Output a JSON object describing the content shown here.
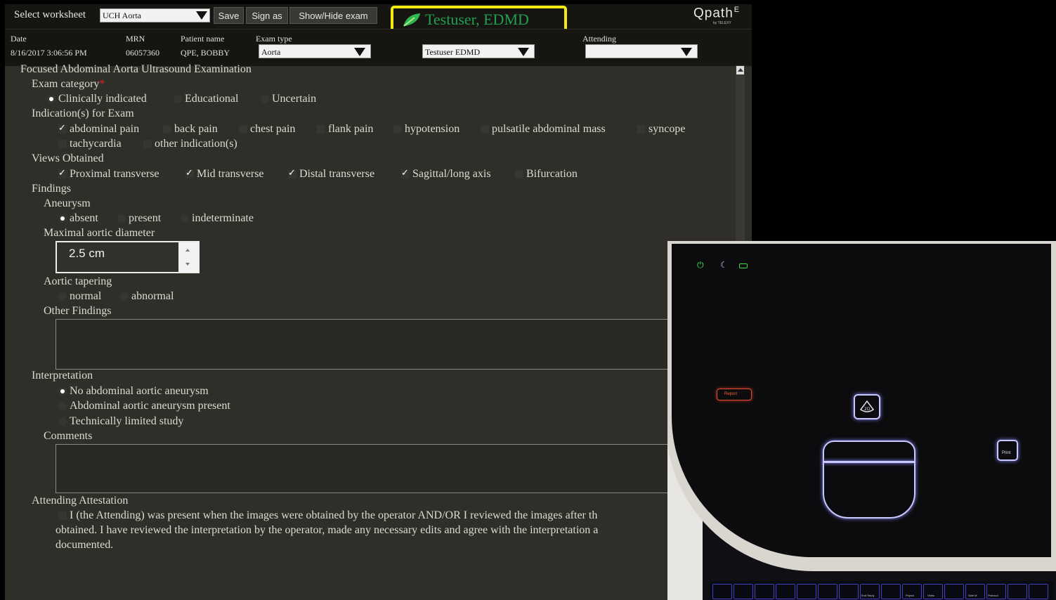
{
  "toolbar": {
    "select_worksheet_label": "Select worksheet",
    "worksheet_value": "UCH Aorta",
    "save_label": "Save",
    "sign_as_label": "Sign as",
    "show_hide_label": "Show/Hide exam",
    "user_name": "Testuser, EDMD",
    "logo": "Qpath",
    "logo_suffix": "E",
    "logo_sub": "by TELEXY"
  },
  "header": {
    "date_label": "Date",
    "date_value": "8/16/2017 3:06:56 PM",
    "mrn_label": "MRN",
    "mrn_value": "06057360",
    "patient_label": "Patient name",
    "patient_value": "QPE, BOBBY",
    "exam_type_label": "Exam type",
    "exam_type_value": "Aorta",
    "operator_value": "Testuser EDMD",
    "attending_label": "Attending",
    "attending_value": ""
  },
  "form": {
    "title": "Focused Abdominal Aorta Ultrasound Examination",
    "exam_category": {
      "label": "Exam category",
      "required_mark": "*",
      "options": [
        {
          "label": "Clinically indicated",
          "selected": true
        },
        {
          "label": "Educational",
          "selected": false
        },
        {
          "label": "Uncertain",
          "selected": false
        }
      ]
    },
    "indications": {
      "label": "Indication(s) for Exam",
      "options": [
        {
          "label": "abdominal pain",
          "checked": true
        },
        {
          "label": "back pain",
          "checked": false
        },
        {
          "label": "chest pain",
          "checked": false
        },
        {
          "label": "flank pain",
          "checked": false
        },
        {
          "label": "hypotension",
          "checked": false
        },
        {
          "label": "pulsatile abdominal mass",
          "checked": false
        },
        {
          "label": "syncope",
          "checked": false
        },
        {
          "label": "tachycardia",
          "checked": false
        },
        {
          "label": "other indication(s)",
          "checked": false
        }
      ]
    },
    "views": {
      "label": "Views Obtained",
      "options": [
        {
          "label": "Proximal transverse",
          "checked": true
        },
        {
          "label": "Mid transverse",
          "checked": true
        },
        {
          "label": "Distal transverse",
          "checked": true
        },
        {
          "label": "Sagittal/long axis",
          "checked": true
        },
        {
          "label": "Bifurcation",
          "checked": false
        }
      ]
    },
    "findings_label": "Findings",
    "aneurysm": {
      "label": "Aneurysm",
      "options": [
        {
          "label": "absent",
          "selected": true
        },
        {
          "label": "present",
          "selected": false
        },
        {
          "label": "indeterminate",
          "selected": false
        }
      ]
    },
    "diameter": {
      "label": "Maximal aortic diameter",
      "value": "2.5 cm"
    },
    "tapering": {
      "label": "Aortic tapering",
      "options": [
        {
          "label": "normal",
          "selected": false
        },
        {
          "label": "abnormal",
          "selected": false
        }
      ]
    },
    "other_findings_label": "Other Findings",
    "interpretation": {
      "label": "Interpretation",
      "options": [
        {
          "label": "No abdominal aortic aneurysm",
          "selected": true
        },
        {
          "label": "Abdominal aortic aneurysm present",
          "selected": false
        },
        {
          "label": "Technically limited study",
          "selected": false
        }
      ]
    },
    "comments_label": "Comments",
    "attestation": {
      "label": "Attending Attestation",
      "line1": "I (the Attending) was present when the images were obtained by the operator AND/OR I reviewed the images after th",
      "line2": "obtained. I have reviewed the interpretation by the operator, made any necessary edits and agree with the interpretation a",
      "line3": "documented."
    }
  },
  "device": {
    "report_label": "Report",
    "mode_label": "2D",
    "print_label": "Print",
    "key_labels": [
      "End Study",
      "Physio",
      "Video",
      "Side M",
      "Protocol"
    ]
  },
  "colors": {
    "user_highlight": "#f3ea12",
    "user_text": "#1fa050",
    "panel_bg": "#2f2e28",
    "bar_bg": "#161511"
  }
}
